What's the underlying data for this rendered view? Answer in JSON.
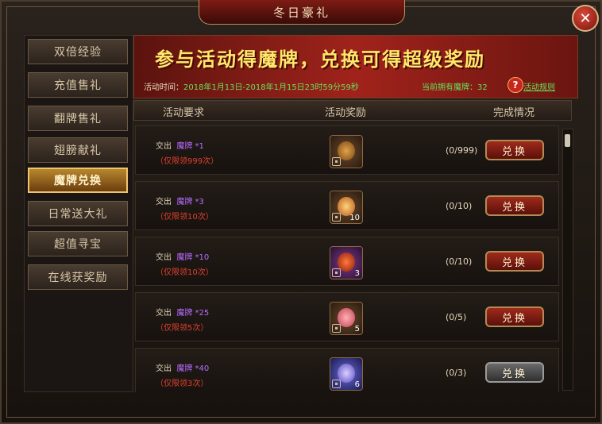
{
  "window": {
    "title": "冬日豪礼",
    "close_symbol": "✕"
  },
  "sidebar": {
    "items": [
      {
        "label": "双倍经验",
        "active": false
      },
      {
        "label": "充值售礼",
        "active": false
      },
      {
        "label": "翻牌售礼",
        "active": false
      },
      {
        "label": "翅膀献礼",
        "active": false
      },
      {
        "label": "魔牌兑换",
        "active": true
      },
      {
        "label": "日常送大礼",
        "active": false
      },
      {
        "label": "超值寻宝",
        "active": false
      },
      {
        "label": "在线获奖励",
        "active": false
      }
    ]
  },
  "banner": {
    "headline": "参与活动得魔牌，兑换可得超级奖励",
    "time_label": "活动时间：",
    "time_value": "2018年1月13日-2018年1月15日23时59分59秒",
    "owned_label": "当前拥有魔牌：",
    "owned_value": "32",
    "help_symbol": "?",
    "rules_link": "活动规则"
  },
  "columns": {
    "requirement": "活动要求",
    "reward": "活动奖励",
    "status": "完成情况"
  },
  "rows": [
    {
      "prefix": "交出",
      "item": "魔牌",
      "count": "*1",
      "limit": "（仅限领999次）",
      "reward_qty": "",
      "progress": "(0/999)",
      "button": "兑换",
      "enabled": true
    },
    {
      "prefix": "交出",
      "item": "魔牌",
      "count": "*3",
      "limit": "（仅限领10次）",
      "reward_qty": "10",
      "progress": "(0/10)",
      "button": "兑换",
      "enabled": true
    },
    {
      "prefix": "交出",
      "item": "魔牌",
      "count": "*10",
      "limit": "（仅限领10次）",
      "reward_qty": "3",
      "progress": "(0/10)",
      "button": "兑换",
      "enabled": true
    },
    {
      "prefix": "交出",
      "item": "魔牌",
      "count": "*25",
      "limit": "（仅限领5次）",
      "reward_qty": "5",
      "progress": "(0/5)",
      "button": "兑换",
      "enabled": true
    },
    {
      "prefix": "交出",
      "item": "魔牌",
      "count": "*40",
      "limit": "（仅限领3次）",
      "reward_qty": "6",
      "progress": "(0/3)",
      "button": "兑换",
      "enabled": false
    }
  ],
  "colors": {
    "accent": "#f0c46d",
    "button_red": "#a02a1c",
    "limit_red": "#e0402f",
    "item_purple": "#b96cff",
    "green": "#68e05b"
  }
}
